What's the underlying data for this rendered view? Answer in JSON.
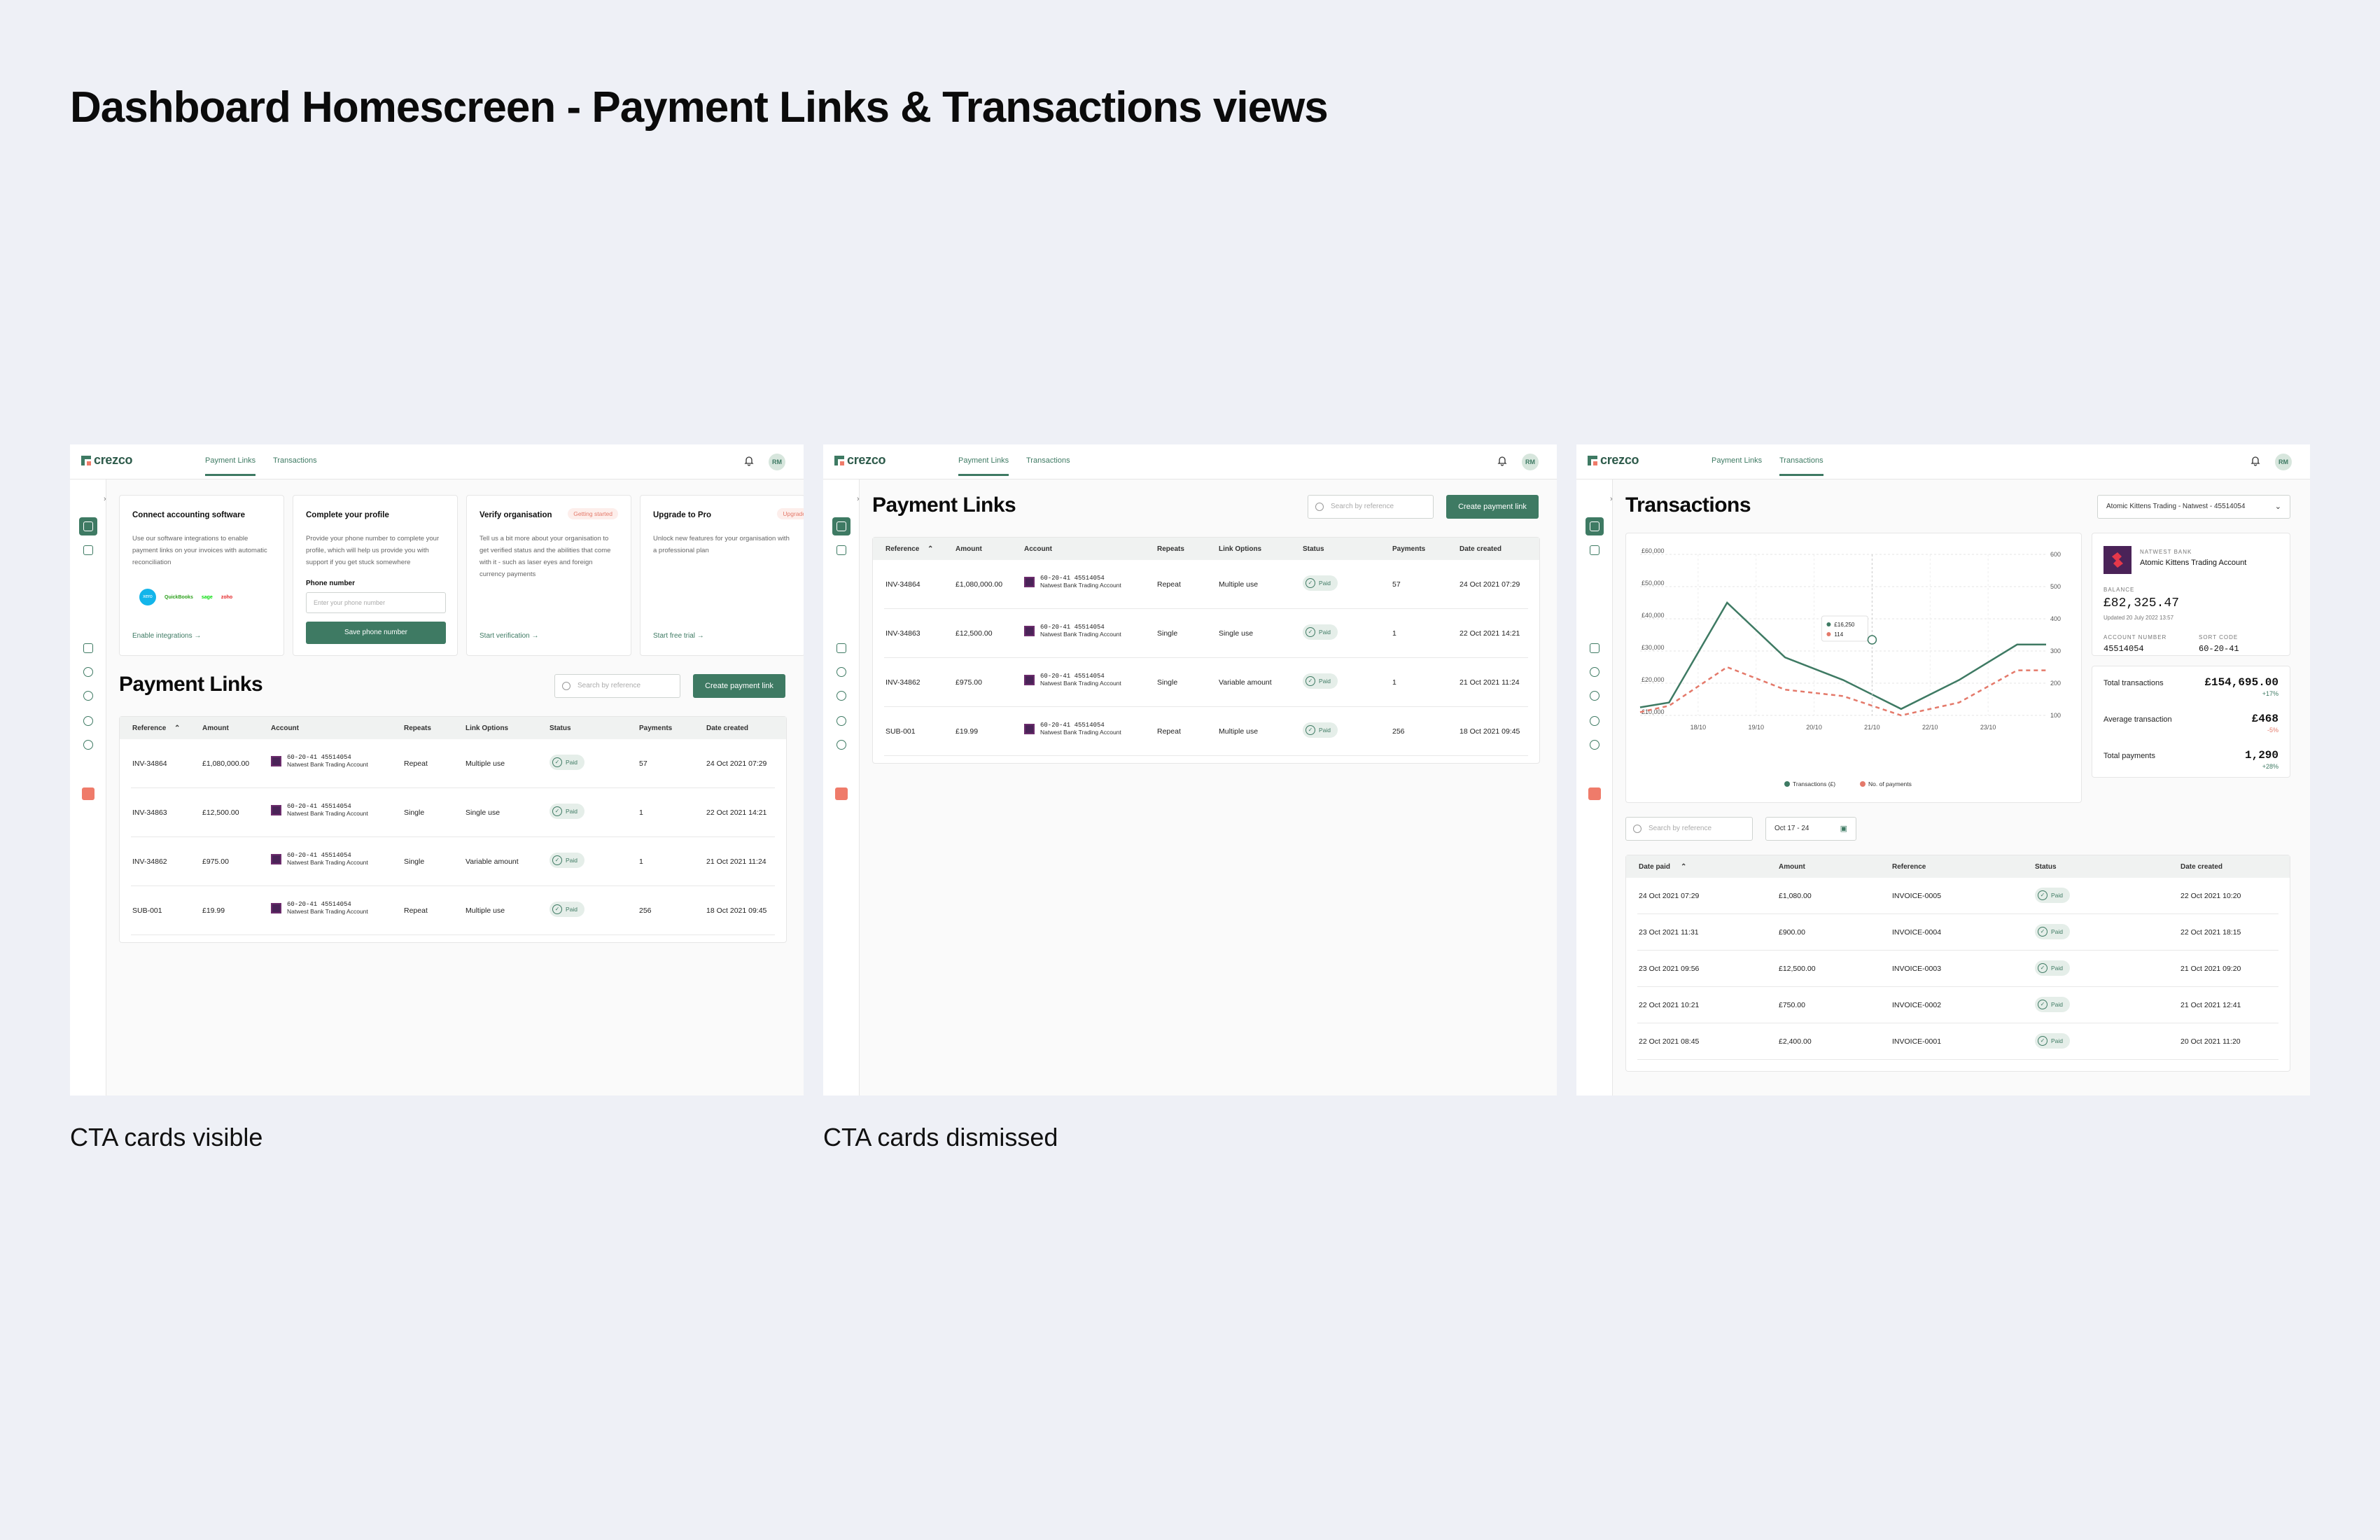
{
  "page_title": "Dashboard Homescreen - Payment Links & Transactions views",
  "captions": {
    "left": "CTA cards visible",
    "middle": "CTA cards dismissed"
  },
  "app": {
    "logo_text": "crezco",
    "nav": {
      "payment_links": "Payment Links",
      "transactions": "Transactions"
    },
    "avatar": "RM"
  },
  "cta": {
    "accounting": {
      "title": "Connect accounting software",
      "body": "Use our software integrations to enable payment links on your invoices with automatic reconciliation",
      "link": "Enable integrations",
      "logos": [
        "xero",
        "QuickBooks",
        "sage",
        "zoho"
      ]
    },
    "profile": {
      "title": "Complete your profile",
      "body": "Provide your phone number to complete your profile, which will help us provide you with support if you get stuck somewhere",
      "phone_label": "Phone number",
      "phone_placeholder": "Enter your phone number",
      "button": "Save phone number"
    },
    "verify": {
      "title": "Verify organisation",
      "badge": "Getting started",
      "body": "Tell us a bit more about your organisation to get verified status and the abilities that come with it - such as laser eyes and foreign currency payments",
      "link": "Start verification"
    },
    "upgrade": {
      "title": "Upgrade to Pro",
      "badge": "Upgrade",
      "body": "Unlock new features for your organisation with a professional plan",
      "link": "Start free trial"
    }
  },
  "payment_links": {
    "title": "Payment Links",
    "search_placeholder": "Search by reference",
    "create_button": "Create payment link",
    "columns": [
      "Reference",
      "Amount",
      "Account",
      "Repeats",
      "Link Options",
      "Status",
      "Payments",
      "Date created"
    ],
    "rows": [
      {
        "reference": "INV-34864",
        "amount": "£1,080,000.00",
        "acc_num": "60-20-41 45514054",
        "acc_name": "Natwest Bank Trading Account",
        "repeats": "Repeat",
        "options": "Multiple use",
        "status": "Paid",
        "payments": "57",
        "date": "24 Oct 2021 07:29"
      },
      {
        "reference": "INV-34863",
        "amount": "£12,500.00",
        "acc_num": "60-20-41 45514054",
        "acc_name": "Natwest Bank Trading Account",
        "repeats": "Single",
        "options": "Single use",
        "status": "Paid",
        "payments": "1",
        "date": "22 Oct 2021 14:21"
      },
      {
        "reference": "INV-34862",
        "amount": "£975.00",
        "acc_num": "60-20-41 45514054",
        "acc_name": "Natwest Bank Trading Account",
        "repeats": "Single",
        "options": "Variable amount",
        "status": "Paid",
        "payments": "1",
        "date": "21 Oct 2021 11:24"
      },
      {
        "reference": "SUB-001",
        "amount": "£19.99",
        "acc_num": "60-20-41 45514054",
        "acc_name": "Natwest Bank Trading Account",
        "repeats": "Repeat",
        "options": "Multiple use",
        "status": "Paid",
        "payments": "256",
        "date": "18 Oct 2021 09:45"
      }
    ]
  },
  "transactions": {
    "title": "Transactions",
    "account_select": "Atomic Kittens Trading - Natwest - 45514054",
    "bank_label": "NATWEST BANK",
    "account_name": "Atomic Kittens Trading Account",
    "balance_label": "BALANCE",
    "balance": "£82,325.47",
    "updated": "Updated 20 July 2022 13:57",
    "account_number_label": "ACCOUNT NUMBER",
    "account_number": "45514054",
    "sort_code_label": "SORT CODE",
    "sort_code": "60-20-41",
    "stats": [
      {
        "label": "Total transactions",
        "value": "£154,695.00",
        "delta": "+17%",
        "color": "#3e7a63"
      },
      {
        "label": "Average transaction",
        "value": "£468",
        "delta": "-5%",
        "color": "#e4796a"
      },
      {
        "label": "Total payments",
        "value": "1,290",
        "delta": "+28%",
        "color": "#3e7a63"
      }
    ],
    "search_placeholder": "Search by reference",
    "date_range": "Oct 17 - 24",
    "columns": [
      "Date paid",
      "Amount",
      "Reference",
      "Status",
      "Date created"
    ],
    "rows": [
      {
        "date_paid": "24 Oct 2021 07:29",
        "amount": "£1,080.00",
        "reference": "INVOICE-0005",
        "status": "Paid",
        "created": "22 Oct 2021 10:20"
      },
      {
        "date_paid": "23 Oct 2021 11:31",
        "amount": "£900.00",
        "reference": "INVOICE-0004",
        "status": "Paid",
        "created": "22 Oct 2021 18:15"
      },
      {
        "date_paid": "23 Oct 2021 09:56",
        "amount": "£12,500.00",
        "reference": "INVOICE-0003",
        "status": "Paid",
        "created": "21 Oct 2021 09:20"
      },
      {
        "date_paid": "22 Oct 2021 10:21",
        "amount": "£750.00",
        "reference": "INVOICE-0002",
        "status": "Paid",
        "created": "21 Oct 2021 12:41"
      },
      {
        "date_paid": "22 Oct 2021 08:45",
        "amount": "£2,400.00",
        "reference": "INVOICE-0001",
        "status": "Paid",
        "created": "20 Oct 2021 11:20"
      }
    ]
  },
  "chart_data": {
    "type": "line",
    "x": [
      "18/10",
      "19/10",
      "20/10",
      "21/10",
      "22/10",
      "23/10"
    ],
    "ylim": [
      10000,
      60000
    ],
    "y2lim": [
      100,
      600
    ],
    "y_ticks": [
      "£60,000",
      "£50,000",
      "£40,000",
      "£30,000",
      "£20,000",
      "£10,000"
    ],
    "y2_ticks": [
      "600",
      "500",
      "400",
      "300",
      "200",
      "100"
    ],
    "series": [
      {
        "name": "Transactions (£)",
        "axis": "left",
        "color": "#3e7a63",
        "style": "solid",
        "points": [
          [
            0,
            12500
          ],
          [
            0.5,
            14000
          ],
          [
            1.5,
            45000
          ],
          [
            2.5,
            28000
          ],
          [
            3.5,
            21000
          ],
          [
            4.5,
            12000
          ],
          [
            5.5,
            21000
          ],
          [
            6.5,
            32000
          ],
          [
            7.0,
            32000
          ]
        ]
      },
      {
        "name": "No. of payments",
        "axis": "right",
        "color": "#e4796a",
        "style": "dashed",
        "points": [
          [
            0,
            110
          ],
          [
            0.5,
            130
          ],
          [
            1.5,
            250
          ],
          [
            2.5,
            180
          ],
          [
            3.5,
            160
          ],
          [
            4.5,
            100
          ],
          [
            5.5,
            140
          ],
          [
            6.5,
            240
          ],
          [
            7.0,
            240
          ]
        ]
      }
    ],
    "tooltip": {
      "values": [
        "£16,250",
        "114"
      ]
    },
    "legend": "bottom"
  }
}
